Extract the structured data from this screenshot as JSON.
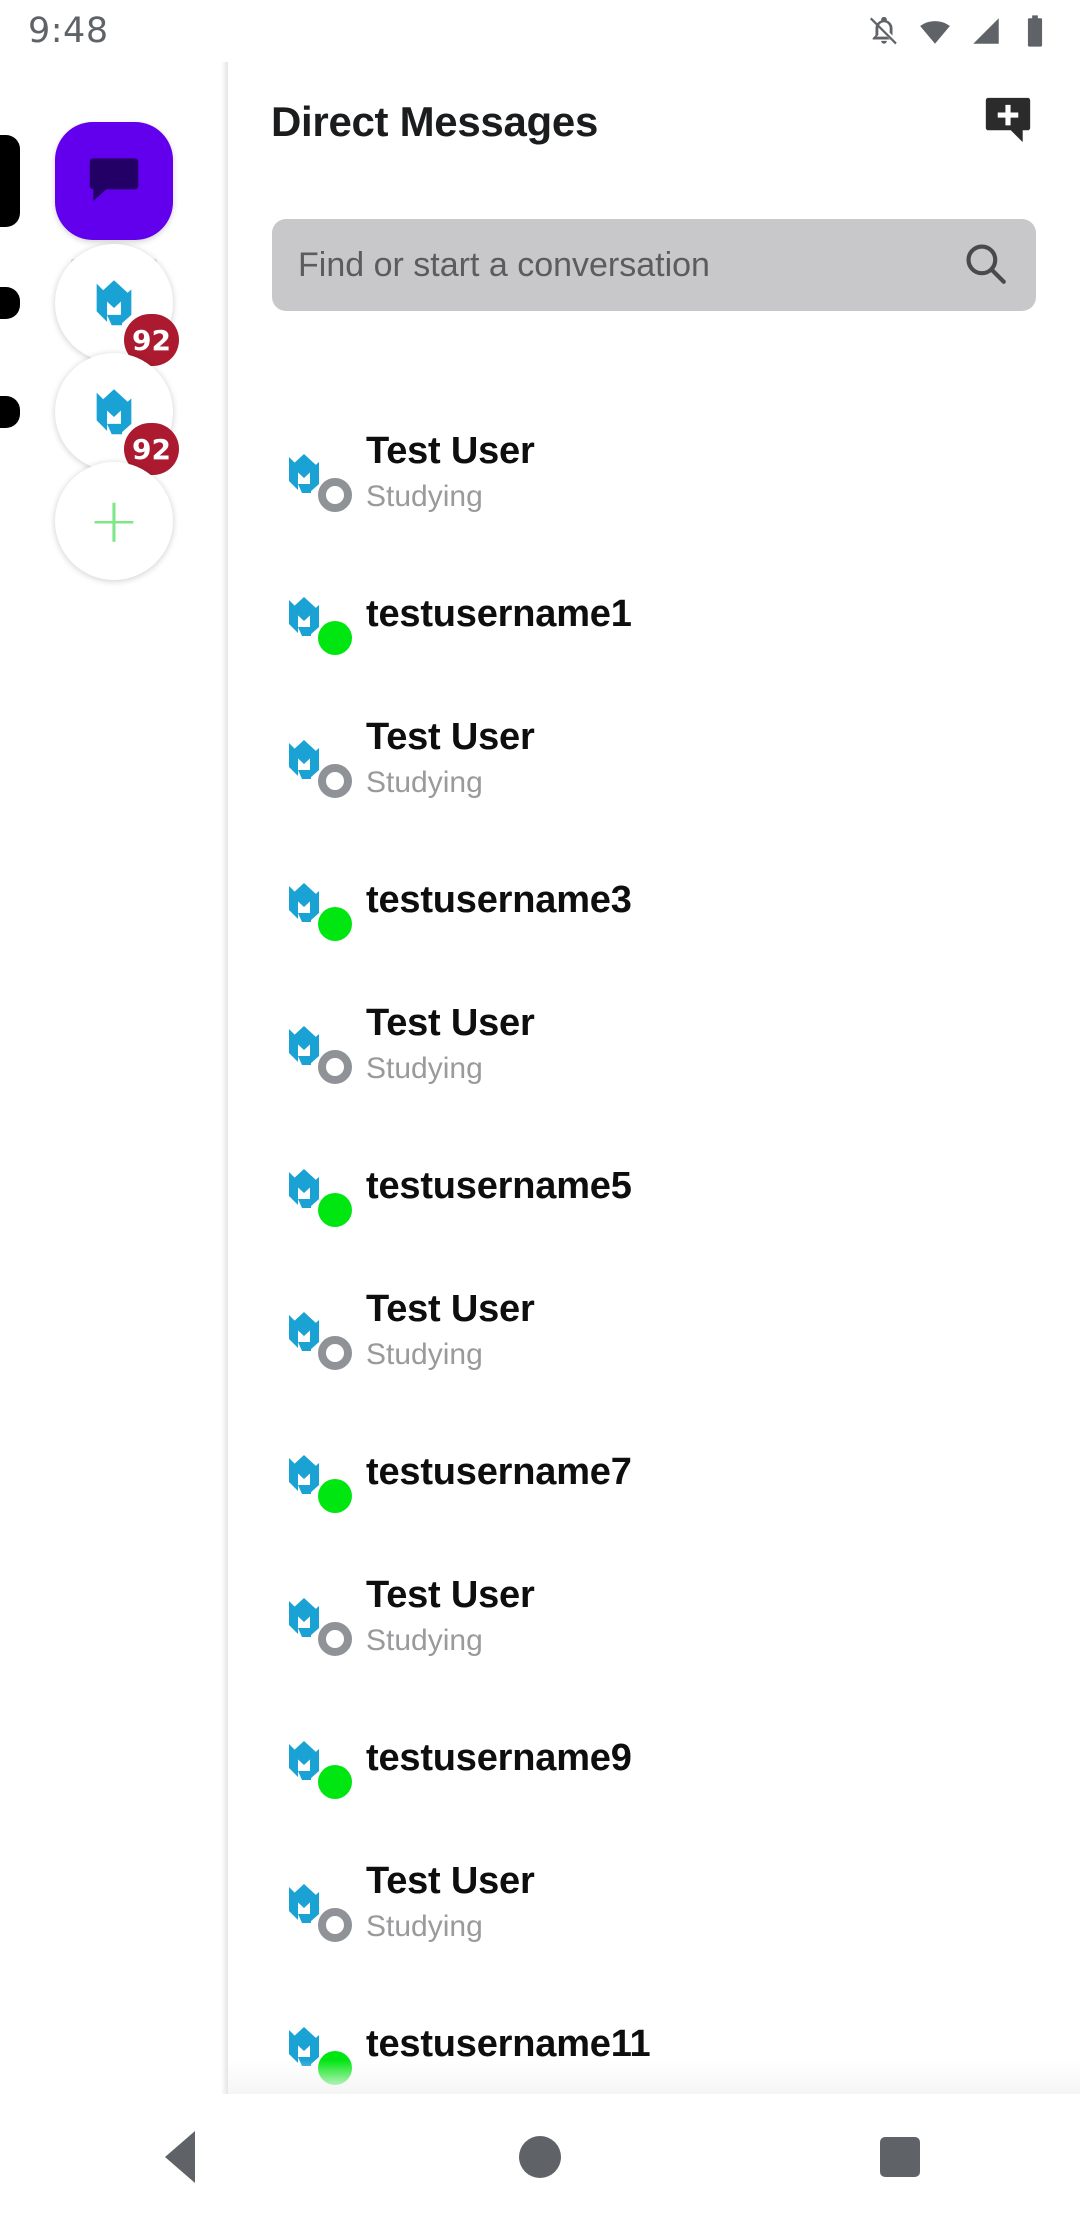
{
  "status_bar": {
    "time": "9:48",
    "icons": [
      {
        "name": "notifications-off-icon"
      },
      {
        "name": "wifi-icon"
      },
      {
        "name": "cellular-signal-icon"
      },
      {
        "name": "battery-icon"
      }
    ]
  },
  "sidebar": {
    "home_button": {
      "name": "direct-messages-home-button",
      "icon": "chat-bubble-icon",
      "color": "#6200ee",
      "active": true
    },
    "servers": [
      {
        "name": "server-1",
        "icon": "mattermost-logo-icon",
        "badge": "92",
        "unread": true
      },
      {
        "name": "server-2",
        "icon": "mattermost-logo-icon",
        "badge": "92",
        "unread": true
      }
    ],
    "add_server": {
      "label": "+",
      "name": "add-server-button",
      "color": "#7ee787"
    }
  },
  "header": {
    "title": "Direct Messages",
    "new_message_icon": "new-message-icon"
  },
  "search": {
    "placeholder": "Find or start a conversation",
    "value": "",
    "icon": "search-icon"
  },
  "colors": {
    "accent_purple": "#6200ee",
    "logo_blue": "#1aa2d4",
    "badge_red": "#ac1a30",
    "online_green": "#00e611",
    "offline_gray": "#8f9297",
    "search_bg": "#c8c8ca"
  },
  "direct_messages": [
    {
      "name": "Test User",
      "status_text": "Studying",
      "presence": "offline"
    },
    {
      "name": "testusername1",
      "status_text": "",
      "presence": "online"
    },
    {
      "name": "Test User",
      "status_text": "Studying",
      "presence": "offline"
    },
    {
      "name": "testusername3",
      "status_text": "",
      "presence": "online"
    },
    {
      "name": "Test User",
      "status_text": "Studying",
      "presence": "offline"
    },
    {
      "name": "testusername5",
      "status_text": "",
      "presence": "online"
    },
    {
      "name": "Test User",
      "status_text": "Studying",
      "presence": "offline"
    },
    {
      "name": "testusername7",
      "status_text": "",
      "presence": "online"
    },
    {
      "name": "Test User",
      "status_text": "Studying",
      "presence": "offline"
    },
    {
      "name": "testusername9",
      "status_text": "",
      "presence": "online"
    },
    {
      "name": "Test User",
      "status_text": "Studying",
      "presence": "offline"
    },
    {
      "name": "testusername11",
      "status_text": "",
      "presence": "online"
    }
  ],
  "nav_bar": {
    "back": "back-button",
    "home": "home-button",
    "recents": "recents-button"
  }
}
